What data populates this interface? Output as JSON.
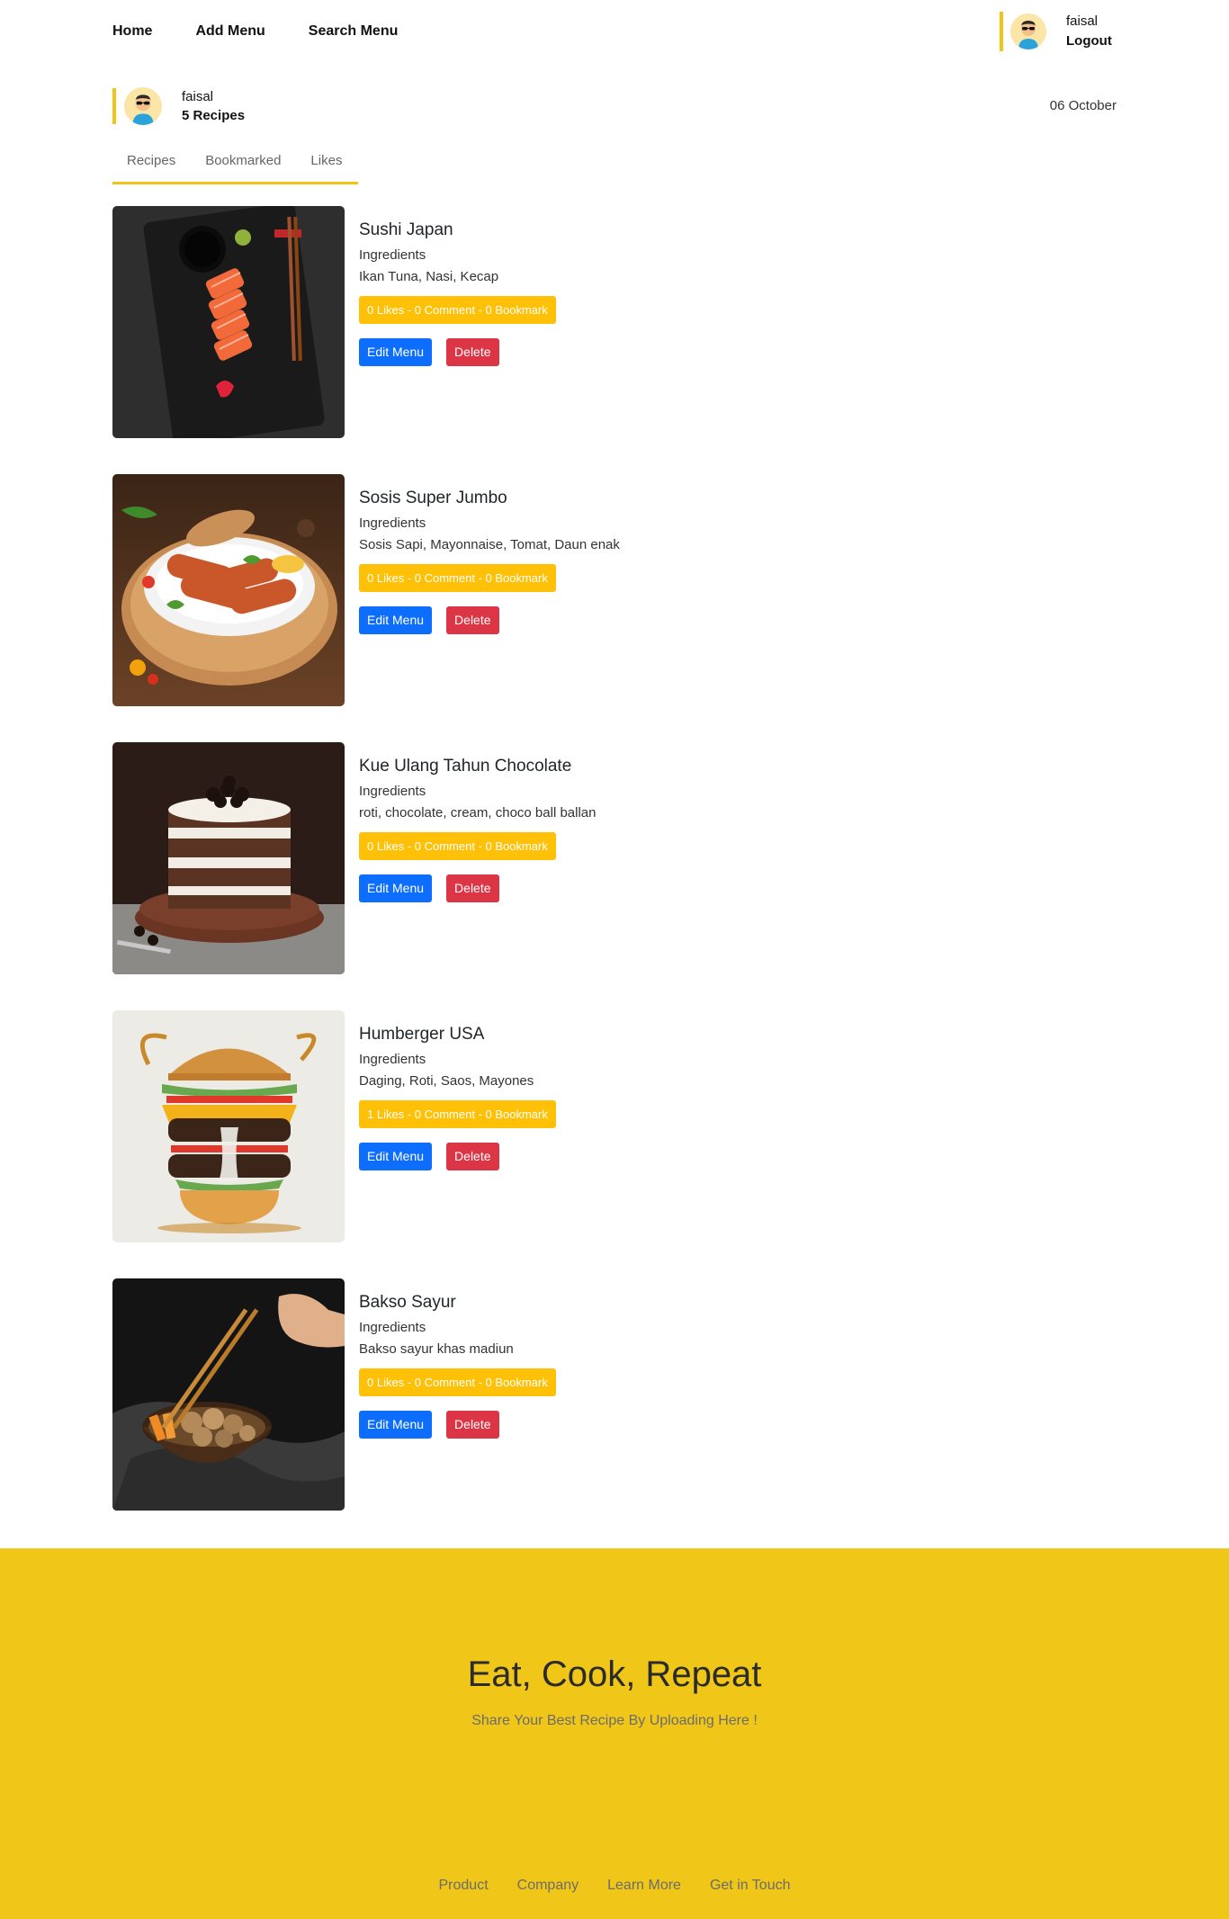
{
  "nav": {
    "links": [
      "Home",
      "Add Menu",
      "Search Menu"
    ],
    "user_name": "faisal",
    "logout_label": "Logout"
  },
  "profile": {
    "name": "faisal",
    "recipe_count": "5 Recipes",
    "date": "06 October"
  },
  "tabs": [
    "Recipes",
    "Bookmarked",
    "Likes"
  ],
  "recipes": [
    {
      "title": "Sushi Japan",
      "ingredients_label": "Ingredients",
      "ingredients": "Ikan Tuna, Nasi, Kecap",
      "stats": "0 Likes - 0 Comment - 0 Bookmark",
      "edit_label": "Edit Menu",
      "delete_label": "Delete"
    },
    {
      "title": "Sosis Super Jumbo",
      "ingredients_label": "Ingredients",
      "ingredients": "Sosis Sapi, Mayonnaise, Tomat, Daun enak",
      "stats": "0 Likes - 0 Comment - 0 Bookmark",
      "edit_label": "Edit Menu",
      "delete_label": "Delete"
    },
    {
      "title": "Kue Ulang Tahun Chocolate",
      "ingredients_label": "Ingredients",
      "ingredients": "roti, chocolate, cream, choco ball ballan",
      "stats": "0 Likes - 0 Comment - 0 Bookmark",
      "edit_label": "Edit Menu",
      "delete_label": "Delete"
    },
    {
      "title": "Humberger USA",
      "ingredients_label": "Ingredients",
      "ingredients": "Daging, Roti, Saos, Mayones",
      "stats": "1 Likes - 0 Comment - 0 Bookmark",
      "edit_label": "Edit Menu",
      "delete_label": "Delete"
    },
    {
      "title": "Bakso Sayur",
      "ingredients_label": "Ingredients",
      "ingredients": "Bakso sayur khas madiun",
      "stats": "0 Likes - 0 Comment - 0 Bookmark",
      "edit_label": "Edit Menu",
      "delete_label": "Delete"
    }
  ],
  "footer": {
    "title": "Eat, Cook, Repeat",
    "subtitle": "Share Your Best Recipe By Uploading Here !",
    "links": [
      "Product",
      "Company",
      "Learn More",
      "Get in Touch"
    ]
  },
  "colors": {
    "accent": "#f0c419",
    "stats_badge": "#ffc107",
    "edit_button": "#0d6efd",
    "delete_button": "#dc3545",
    "footer_bg": "#f0c619"
  }
}
